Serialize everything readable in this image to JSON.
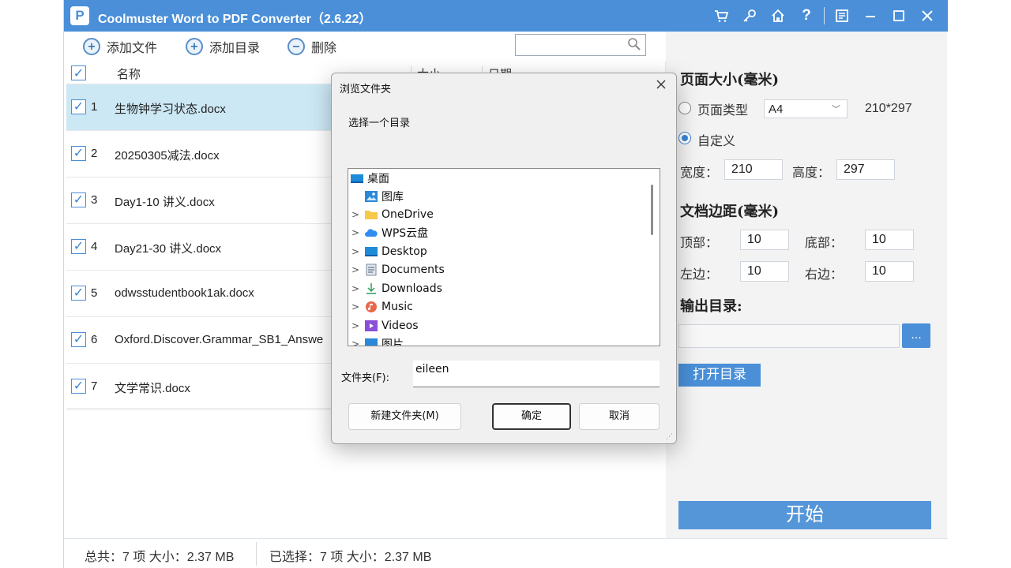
{
  "app": {
    "title": "Coolmuster Word to PDF Converter（2.6.22）",
    "logo_letter": "P",
    "titlebar_icons": [
      "cart-icon",
      "key-icon",
      "home-icon",
      "help-icon",
      "feedback-icon",
      "minimize-icon",
      "maximize-icon",
      "close-icon"
    ]
  },
  "toolbar": {
    "add_file": "添加文件",
    "add_folder": "添加目录",
    "delete": "删除",
    "search_placeholder": ""
  },
  "table": {
    "headers": {
      "name": "名称",
      "size": "大小",
      "date": "日期"
    },
    "rows": [
      {
        "num": "1",
        "name": "生物钟学习状态.docx",
        "checked": true,
        "selected": true
      },
      {
        "num": "2",
        "name": "20250305减法.docx",
        "checked": true,
        "selected": false
      },
      {
        "num": "3",
        "name": "Day1-10 讲义.docx",
        "checked": true,
        "selected": false
      },
      {
        "num": "4",
        "name": "Day21-30 讲义.docx",
        "checked": true,
        "selected": false
      },
      {
        "num": "5",
        "name": "odwsstudentbook1ak.docx",
        "checked": true,
        "selected": false
      },
      {
        "num": "6",
        "name": "Oxford.Discover.Grammar_SB1_Answe",
        "checked": true,
        "selected": false
      },
      {
        "num": "7",
        "name": "文学常识.docx",
        "checked": true,
        "selected": false
      }
    ]
  },
  "status": {
    "total": "总共：7 项 大小：2.37 MB",
    "selected": "已选择：7 项 大小：2.37 MB"
  },
  "settings": {
    "page_size_title": "页面大小(毫米)",
    "page_type_label": "页面类型",
    "page_type_value": "A4",
    "page_type_dims": "210*297",
    "custom_label": "自定义",
    "width_label": "宽度：",
    "width_value": "210",
    "height_label": "高度：",
    "height_value": "297",
    "margin_title": "文档边距(毫米)",
    "top_label": "顶部：",
    "top_value": "10",
    "bottom_label": "底部：",
    "bottom_value": "10",
    "left_label": "左边：",
    "left_value": "10",
    "right_label": "右边：",
    "right_value": "10",
    "output_title": "输出目录:",
    "output_value": "",
    "browse_label": "...",
    "open_dir_label": "打开目录",
    "start_label": "开始"
  },
  "dialog": {
    "title": "浏览文件夹",
    "prompt": "选择一个目录",
    "tree": [
      {
        "label": "桌面",
        "icon": "desktop-folder-icon",
        "level": 0,
        "chevron": ""
      },
      {
        "label": "图库",
        "icon": "gallery-icon",
        "level": 1,
        "chevron": ""
      },
      {
        "label": "OneDrive",
        "icon": "folder-icon",
        "level": 1,
        "chevron": ">"
      },
      {
        "label": "WPS云盘",
        "icon": "cloud-icon",
        "level": 1,
        "chevron": ">"
      },
      {
        "label": "Desktop",
        "icon": "desktop-folder-icon",
        "level": 1,
        "chevron": ">"
      },
      {
        "label": "Documents",
        "icon": "documents-icon",
        "level": 1,
        "chevron": ">"
      },
      {
        "label": "Downloads",
        "icon": "download-icon",
        "level": 1,
        "chevron": ">"
      },
      {
        "label": "Music",
        "icon": "music-icon",
        "level": 1,
        "chevron": ">"
      },
      {
        "label": "Videos",
        "icon": "video-icon",
        "level": 1,
        "chevron": ">"
      },
      {
        "label": "图片",
        "icon": "pictures-icon",
        "level": 1,
        "chevron": ">"
      }
    ],
    "folder_label": "文件夹(F):",
    "folder_value": "eileen",
    "new_folder": "新建文件夹(M)",
    "ok": "确定",
    "cancel": "取消"
  },
  "colors": {
    "accent": "#4a8fd8",
    "selected_row": "#cde8f5",
    "panel_bg": "#f3f3f3"
  }
}
